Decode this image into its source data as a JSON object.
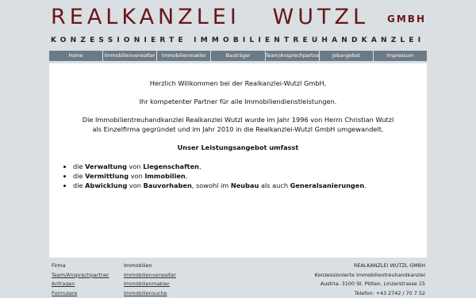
{
  "logo": {
    "main": "REALKANZLEI   WUTZL",
    "gmbh": "GMBH",
    "tagline": "KONZESSIONIERTE IMMOBILIENTREUHANDKANZLEI"
  },
  "nav": {
    "items": [
      {
        "label": "Home"
      },
      {
        "label": "Immobilienverwalter"
      },
      {
        "label": "Immobilienmakler"
      },
      {
        "label": "Bauträger"
      },
      {
        "label": "Team/Ansprechpartner"
      },
      {
        "label": "Jobangebot"
      },
      {
        "label": "Impressum"
      }
    ]
  },
  "content": {
    "welcome": "Herzlich Willkommen bei der Realkanzlei-Wutzl GmbH,",
    "partner": "Ihr kompetenter Partner für alle Immobiliendienstleistungen.",
    "history_1": "Die Immobilientreuhandkanzlei Realkanzlei Wutzl wurde im Jahr 1996 von Herrn Christian Wutzl",
    "history_2": "als Einzelfirma gegründet und im Jahr 2010 in die Realkanzlei-Wutzl GmbH umgewandelt.",
    "offer_heading": "Unser Leistungsangebot umfasst",
    "offers": [
      {
        "p1": "die ",
        "b1": "Verwaltung",
        "p2": " von ",
        "b2": "Liegenschaften",
        "p3": ",",
        "b3": "",
        "p4": "",
        "b4": "",
        "p5": ""
      },
      {
        "p1": "die ",
        "b1": "Vermittlung",
        "p2": " von ",
        "b2": "Immobilien",
        "p3": ",",
        "b3": "",
        "p4": "",
        "b4": "",
        "p5": ""
      },
      {
        "p1": "die ",
        "b1": "Abwicklung",
        "p2": " von ",
        "b2": "Bauvorhaben",
        "p3": ", sowohl im ",
        "b3": "Neubau",
        "p4": " als auch ",
        "b4": "Generalsanierungen",
        "p5": "."
      }
    ]
  },
  "footer": {
    "col1": {
      "heading": "Firma",
      "links": [
        "Team/Ansprechpartner",
        "Anfragen",
        "Formulare"
      ]
    },
    "col2": {
      "heading": "Immobilien",
      "links": [
        "Immobilienverwalter",
        "Immobilienmakler",
        "Immobiliensuche"
      ]
    },
    "col3": {
      "company": "REALKANZLEI WUTZL GMBH",
      "tagline": "Konzessionierte Immobilientreuhandkanzlei",
      "address": "Austria- 3100 St. Pölten, Linzerstrasse 15",
      "phone": "Telefon: +43 2742 / 70 7 52"
    }
  },
  "colors": {
    "brand": "#6b1518",
    "nav": "#6c7a85",
    "background": "#d9dfe3"
  }
}
